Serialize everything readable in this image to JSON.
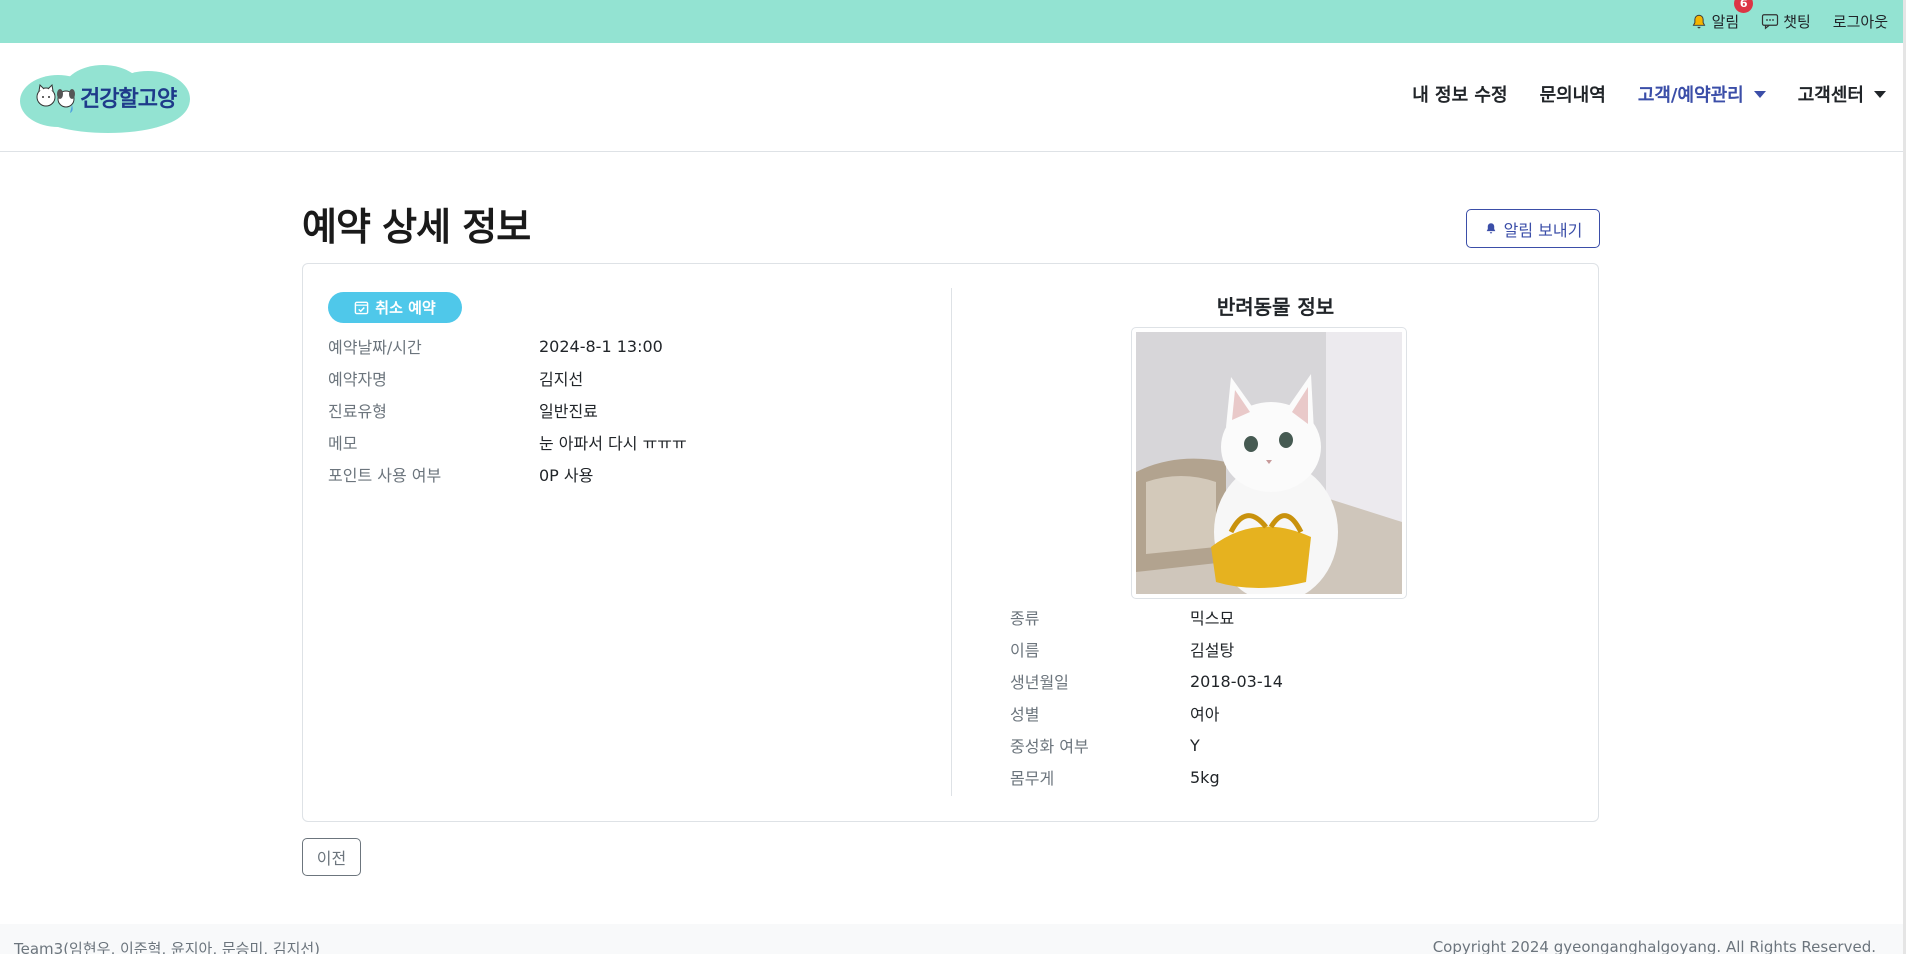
{
  "topbar": {
    "alarm_label": "알림",
    "alarm_count": "6",
    "chat_label": "챗팅",
    "logout_label": "로그아웃"
  },
  "header": {
    "logo_text": "건강할고양",
    "nav": [
      {
        "label": "내 정보 수정"
      },
      {
        "label": "문의내역"
      },
      {
        "label": "고객/예약관리"
      },
      {
        "label": "고객센터"
      }
    ]
  },
  "main": {
    "title": "예약 상세 정보",
    "notify_button": "알림 보내기",
    "status_label": "취소 예약",
    "reservation": [
      {
        "label": "예약날짜/시간",
        "value": "2024-8-1 13:00"
      },
      {
        "label": "예약자명",
        "value": "김지선"
      },
      {
        "label": "진료유형",
        "value": "일반진료"
      },
      {
        "label": "메모",
        "value": "눈 아파서 다시 ㅠㅠㅠ"
      },
      {
        "label": "포인트 사용 여부",
        "value": "0P 사용"
      }
    ],
    "pet_title": "반려동물 정보",
    "pet": [
      {
        "label": "종류",
        "value": "믹스묘"
      },
      {
        "label": "이름",
        "value": "김설탕"
      },
      {
        "label": "생년월일",
        "value": "2018-03-14"
      },
      {
        "label": "성별",
        "value": "여아"
      },
      {
        "label": "중성화 여부",
        "value": "Y"
      },
      {
        "label": "몸무게",
        "value": "5kg"
      }
    ],
    "back_button": "이전"
  },
  "footer": {
    "left": "Team3(임현우, 이준혁, 윤지아, 문승미, 김지선)",
    "right": "Copyright 2024 gyeonganghalgoyang. All Rights Reserved."
  },
  "colors": {
    "topbar_bg": "#93e3d2",
    "accent": "#3b4ea8",
    "status_pill": "#4fc8ea",
    "badge": "#dc3545"
  },
  "icons": {
    "alarm": "bell-icon",
    "chat": "chat-icon",
    "status": "calendar-check-icon",
    "notify": "bell-icon",
    "nav_dropdown": "caret-down-icon"
  }
}
